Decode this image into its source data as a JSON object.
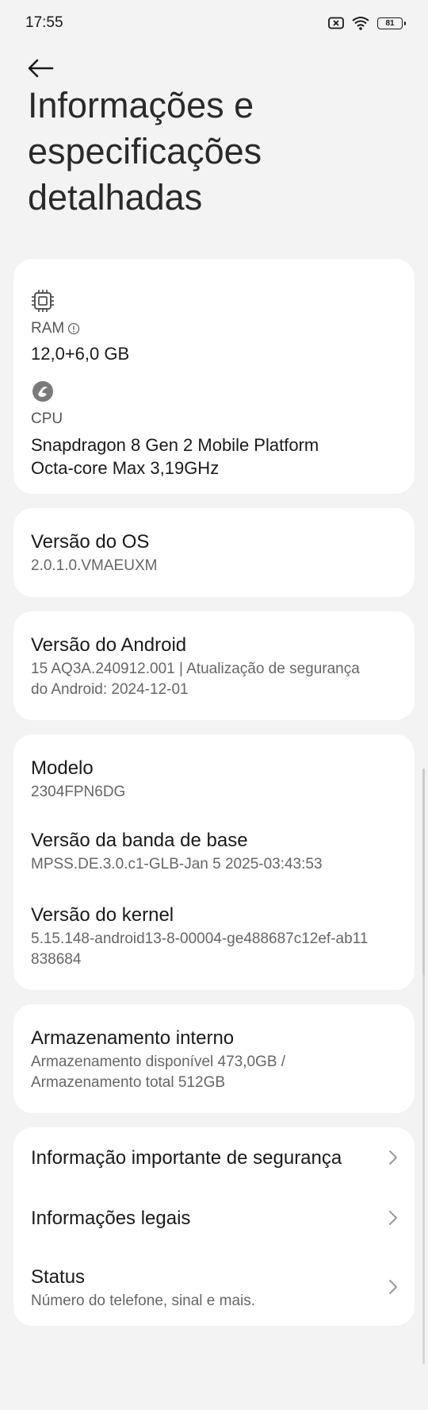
{
  "status_bar": {
    "time": "17:55",
    "battery": "81"
  },
  "page": {
    "title": "Informações e especificações detalhadas"
  },
  "hardware": {
    "ram_label": "RAM",
    "ram_value": "12,0+6,0 GB",
    "cpu_label": "CPU",
    "cpu_line1": "Snapdragon 8 Gen 2 Mobile Platform",
    "cpu_line2": "Octa-core Max 3,19GHz"
  },
  "os_version": {
    "title": "Versão do OS",
    "value": "2.0.1.0.VMAEUXM"
  },
  "android_version": {
    "title": "Versão do Android",
    "line1": "15 AQ3A.240912.001 | Atualização de segurança",
    "line2": "do Android: 2024-12-01"
  },
  "device_info": {
    "model_title": "Modelo",
    "model_value": "2304FPN6DG",
    "baseband_title": "Versão da banda de base",
    "baseband_value": "MPSS.DE.3.0.c1-GLB-Jan  5 2025-03:43:53",
    "kernel_title": "Versão do kernel",
    "kernel_line1": "5.15.148-android13-8-00004-ge488687c12ef-ab11",
    "kernel_line2": "838684"
  },
  "storage": {
    "title": "Armazenamento interno",
    "line1": "Armazenamento disponível  473,0GB /",
    "line2": "Armazenamento total  512GB"
  },
  "links": {
    "safety": "Informação importante de segurança",
    "legal": "Informações legais",
    "status_title": "Status",
    "status_sub": "Número do telefone, sinal e mais."
  }
}
